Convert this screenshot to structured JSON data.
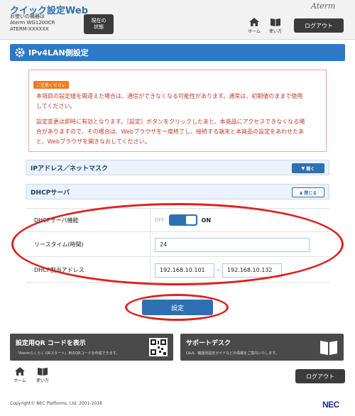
{
  "header": {
    "app_title": "クイック設定Web",
    "device_label": "お使いの機器は",
    "device_model": "Aterm WG1200CR",
    "device_id": "ATERM-XXXXXX",
    "status_line1": "現在の",
    "status_line2": "状態",
    "brand": "Aterm",
    "home_label": "ホーム",
    "help_label": "使い方",
    "logout_label": "ログアウト"
  },
  "section": {
    "title": "IPv4LAN側設定"
  },
  "warning": {
    "badge": "ご注意ください",
    "line1": "本項目の設定値を間違えた場合は、通信ができなくなる可能性があります。通常は、初期値のままで使用",
    "line2": "してください。",
    "line3": "設定変更は即時に有効となります。［設定］ボタンをクリックしたあと、本商品にアクセスできなくなる場",
    "line4": "合がありますので、その場合は、Webブラウザを一度終了し、接続する端末と本商品の設定をあわせたあ",
    "line5": "と、Webブラウザを開きなおしてください。"
  },
  "accordions": {
    "ip": {
      "label": "IPアドレス／ネットマスク",
      "button": "開く"
    },
    "dhcp": {
      "label": "DHCPサーバ",
      "button": "閉じる"
    }
  },
  "form": {
    "dhcp_function": {
      "label": "DHCPサーバ機能",
      "off": "OFF",
      "on": "ON"
    },
    "lease_time": {
      "label": "リースタイム(時間)",
      "value": "24"
    },
    "address_range": {
      "label": "DHCP割当アドレス",
      "start": "192.168.10.101",
      "end": "192.168.10.132",
      "separator": "-"
    }
  },
  "submit": {
    "label": "設定"
  },
  "bottom": {
    "qr_title": "設定用QR コードを表示",
    "qr_sub": "「Atermらくらく QRスタート」用のQRコードを作成できます。",
    "support_title": "サポートデスク",
    "support_sub": "Q&A、機能別設定ガイドなどの情報をご案内いたします。",
    "home_label": "ホーム",
    "help_label": "使い方",
    "logout_label": "ログアウト"
  },
  "footer": {
    "copyright": "Copyright© NEC Platforms, Ltd. 2001-2018",
    "logo": "NEC"
  },
  "colors": {
    "accent": "#2f6fb3",
    "highlight": "#e02020",
    "warning": "#c0392b"
  }
}
